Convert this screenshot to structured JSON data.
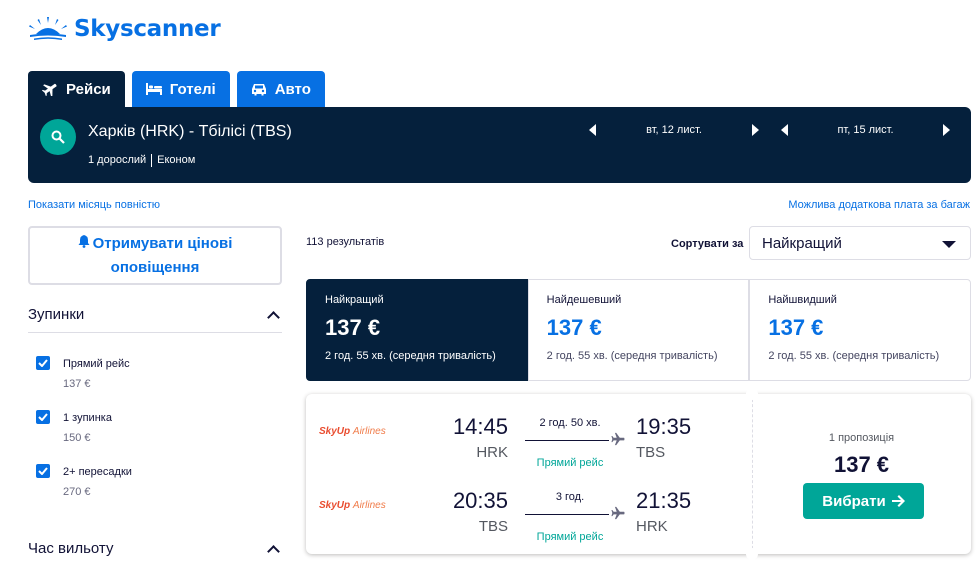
{
  "brand": {
    "name": "Skyscanner",
    "color": "#0770e3"
  },
  "tabs": [
    {
      "label": "Рейси",
      "icon": "plane-icon",
      "active": true
    },
    {
      "label": "Готелі",
      "icon": "bed-icon",
      "active": false
    },
    {
      "label": "Авто",
      "icon": "car-icon",
      "active": false
    }
  ],
  "search": {
    "route": "Харків (HRK) - Тбілісі (TBS)",
    "passengers": "1 дорослий",
    "cabin": "Економ",
    "depart_date": "вт, 12 лист.",
    "return_date": "пт, 15 лист."
  },
  "links": {
    "show_month": "Показати місяць повністю",
    "baggage_fees": "Можлива додаткова плата за багаж"
  },
  "price_alert": {
    "line1": "Отримувати цінові",
    "line2": "оповіщення"
  },
  "filters": {
    "stops_title": "Зупинки",
    "stops": [
      {
        "label": "Прямий рейс",
        "price": "137 €",
        "checked": true
      },
      {
        "label": "1 зупинка",
        "price": "150 €",
        "checked": true
      },
      {
        "label": "2+ пересадки",
        "price": "270 €",
        "checked": true
      }
    ],
    "departure_title": "Час вильоту"
  },
  "results": {
    "count": "113 результатів",
    "sort_label": "Сортувати за",
    "sort_value": "Найкращий"
  },
  "sort_tabs": [
    {
      "title": "Найкращий",
      "price": "137 €",
      "duration": "2 год. 55 хв. (середня тривалість)",
      "active": true
    },
    {
      "title": "Найдешевший",
      "price": "137 €",
      "duration": "2 год. 55 хв. (середня тривалість)",
      "active": false
    },
    {
      "title": "Найшвидший",
      "price": "137 €",
      "duration": "2 год. 55 хв. (середня тривалість)",
      "active": false
    }
  ],
  "flight": {
    "legs": [
      {
        "airline": "SkyUp",
        "airline_sub": "Airlines",
        "dep_time": "14:45",
        "dep_code": "HRK",
        "duration": "2 год. 50 хв.",
        "stops": "Прямий рейс",
        "arr_time": "19:35",
        "arr_code": "TBS"
      },
      {
        "airline": "SkyUp",
        "airline_sub": "Airlines",
        "dep_time": "20:35",
        "dep_code": "TBS",
        "duration": "3 год.",
        "stops": "Прямий рейс",
        "arr_time": "21:35",
        "arr_code": "HRK"
      }
    ],
    "offers": "1 пропозиція",
    "price": "137 €",
    "select_label": "Вибрати"
  },
  "colors": {
    "navy": "#05203c",
    "blue": "#0770e3",
    "teal": "#00a698"
  }
}
